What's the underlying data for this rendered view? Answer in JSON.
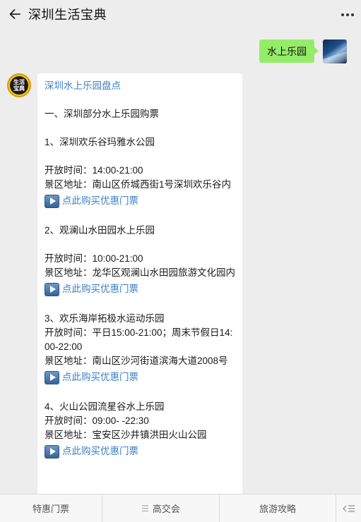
{
  "header": {
    "title": "深圳生活宝典"
  },
  "outgoing": {
    "text": "水上乐园"
  },
  "bot": {
    "avatar_text_top": "生活",
    "avatar_text_bottom": "宝典"
  },
  "message": {
    "title": "深圳水上乐园盘点",
    "section": "一、深圳部分水上乐园购票",
    "parks": [
      {
        "name": "1、深圳欢乐谷玛雅水公园",
        "hours": "开放时间：14:00-21:00",
        "address": "景区地址：南山区侨城西街1号深圳欢乐谷内",
        "buy": "点此购买优惠门票"
      },
      {
        "name": "2、观澜山水田园水上乐园",
        "hours": "开放时间：10:00-21:00",
        "address": "景区地址：龙华区观澜山水田园旅游文化园内",
        "buy": "点此购买优惠门票"
      },
      {
        "name": "3、欢乐海岸拓极水运动乐园",
        "hours": "开放时间：平日15:00-21:00；周末节假日14:00-22:00",
        "address": "景区地址：南山区沙河街道滨海大道2008号",
        "buy": "点此购买优惠门票"
      },
      {
        "name": "4、火山公园流星谷水上乐园",
        "hours": "开放时间：09:00- -22:30",
        "address": "景区地址：宝安区沙井镇洪田火山公园",
        "buy": "点此购买优惠门票"
      }
    ]
  },
  "menu": {
    "items": [
      "特惠门票",
      "高交会",
      "旅游攻略"
    ]
  }
}
